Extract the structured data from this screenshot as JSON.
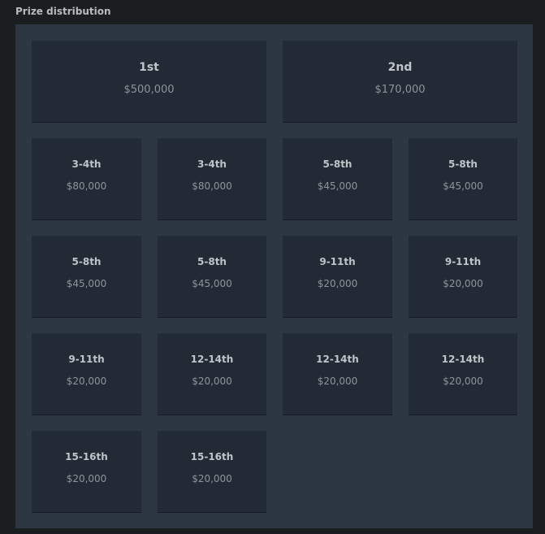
{
  "section": {
    "title": "Prize distribution"
  },
  "prizes": [
    {
      "place": "1st",
      "amount": "$500,000"
    },
    {
      "place": "2nd",
      "amount": "$170,000"
    },
    {
      "place": "3-4th",
      "amount": "$80,000"
    },
    {
      "place": "3-4th",
      "amount": "$80,000"
    },
    {
      "place": "5-8th",
      "amount": "$45,000"
    },
    {
      "place": "5-8th",
      "amount": "$45,000"
    },
    {
      "place": "5-8th",
      "amount": "$45,000"
    },
    {
      "place": "5-8th",
      "amount": "$45,000"
    },
    {
      "place": "9-11th",
      "amount": "$20,000"
    },
    {
      "place": "9-11th",
      "amount": "$20,000"
    },
    {
      "place": "9-11th",
      "amount": "$20,000"
    },
    {
      "place": "12-14th",
      "amount": "$20,000"
    },
    {
      "place": "12-14th",
      "amount": "$20,000"
    },
    {
      "place": "12-14th",
      "amount": "$20,000"
    },
    {
      "place": "15-16th",
      "amount": "$20,000"
    },
    {
      "place": "15-16th",
      "amount": "$20,000"
    }
  ],
  "colors": {
    "page_bg": "#1b1e21",
    "panel_bg": "#2d3743",
    "card_bg": "#222b35",
    "place_text": "#c0c4c8",
    "amount_text": "#8c949b"
  }
}
